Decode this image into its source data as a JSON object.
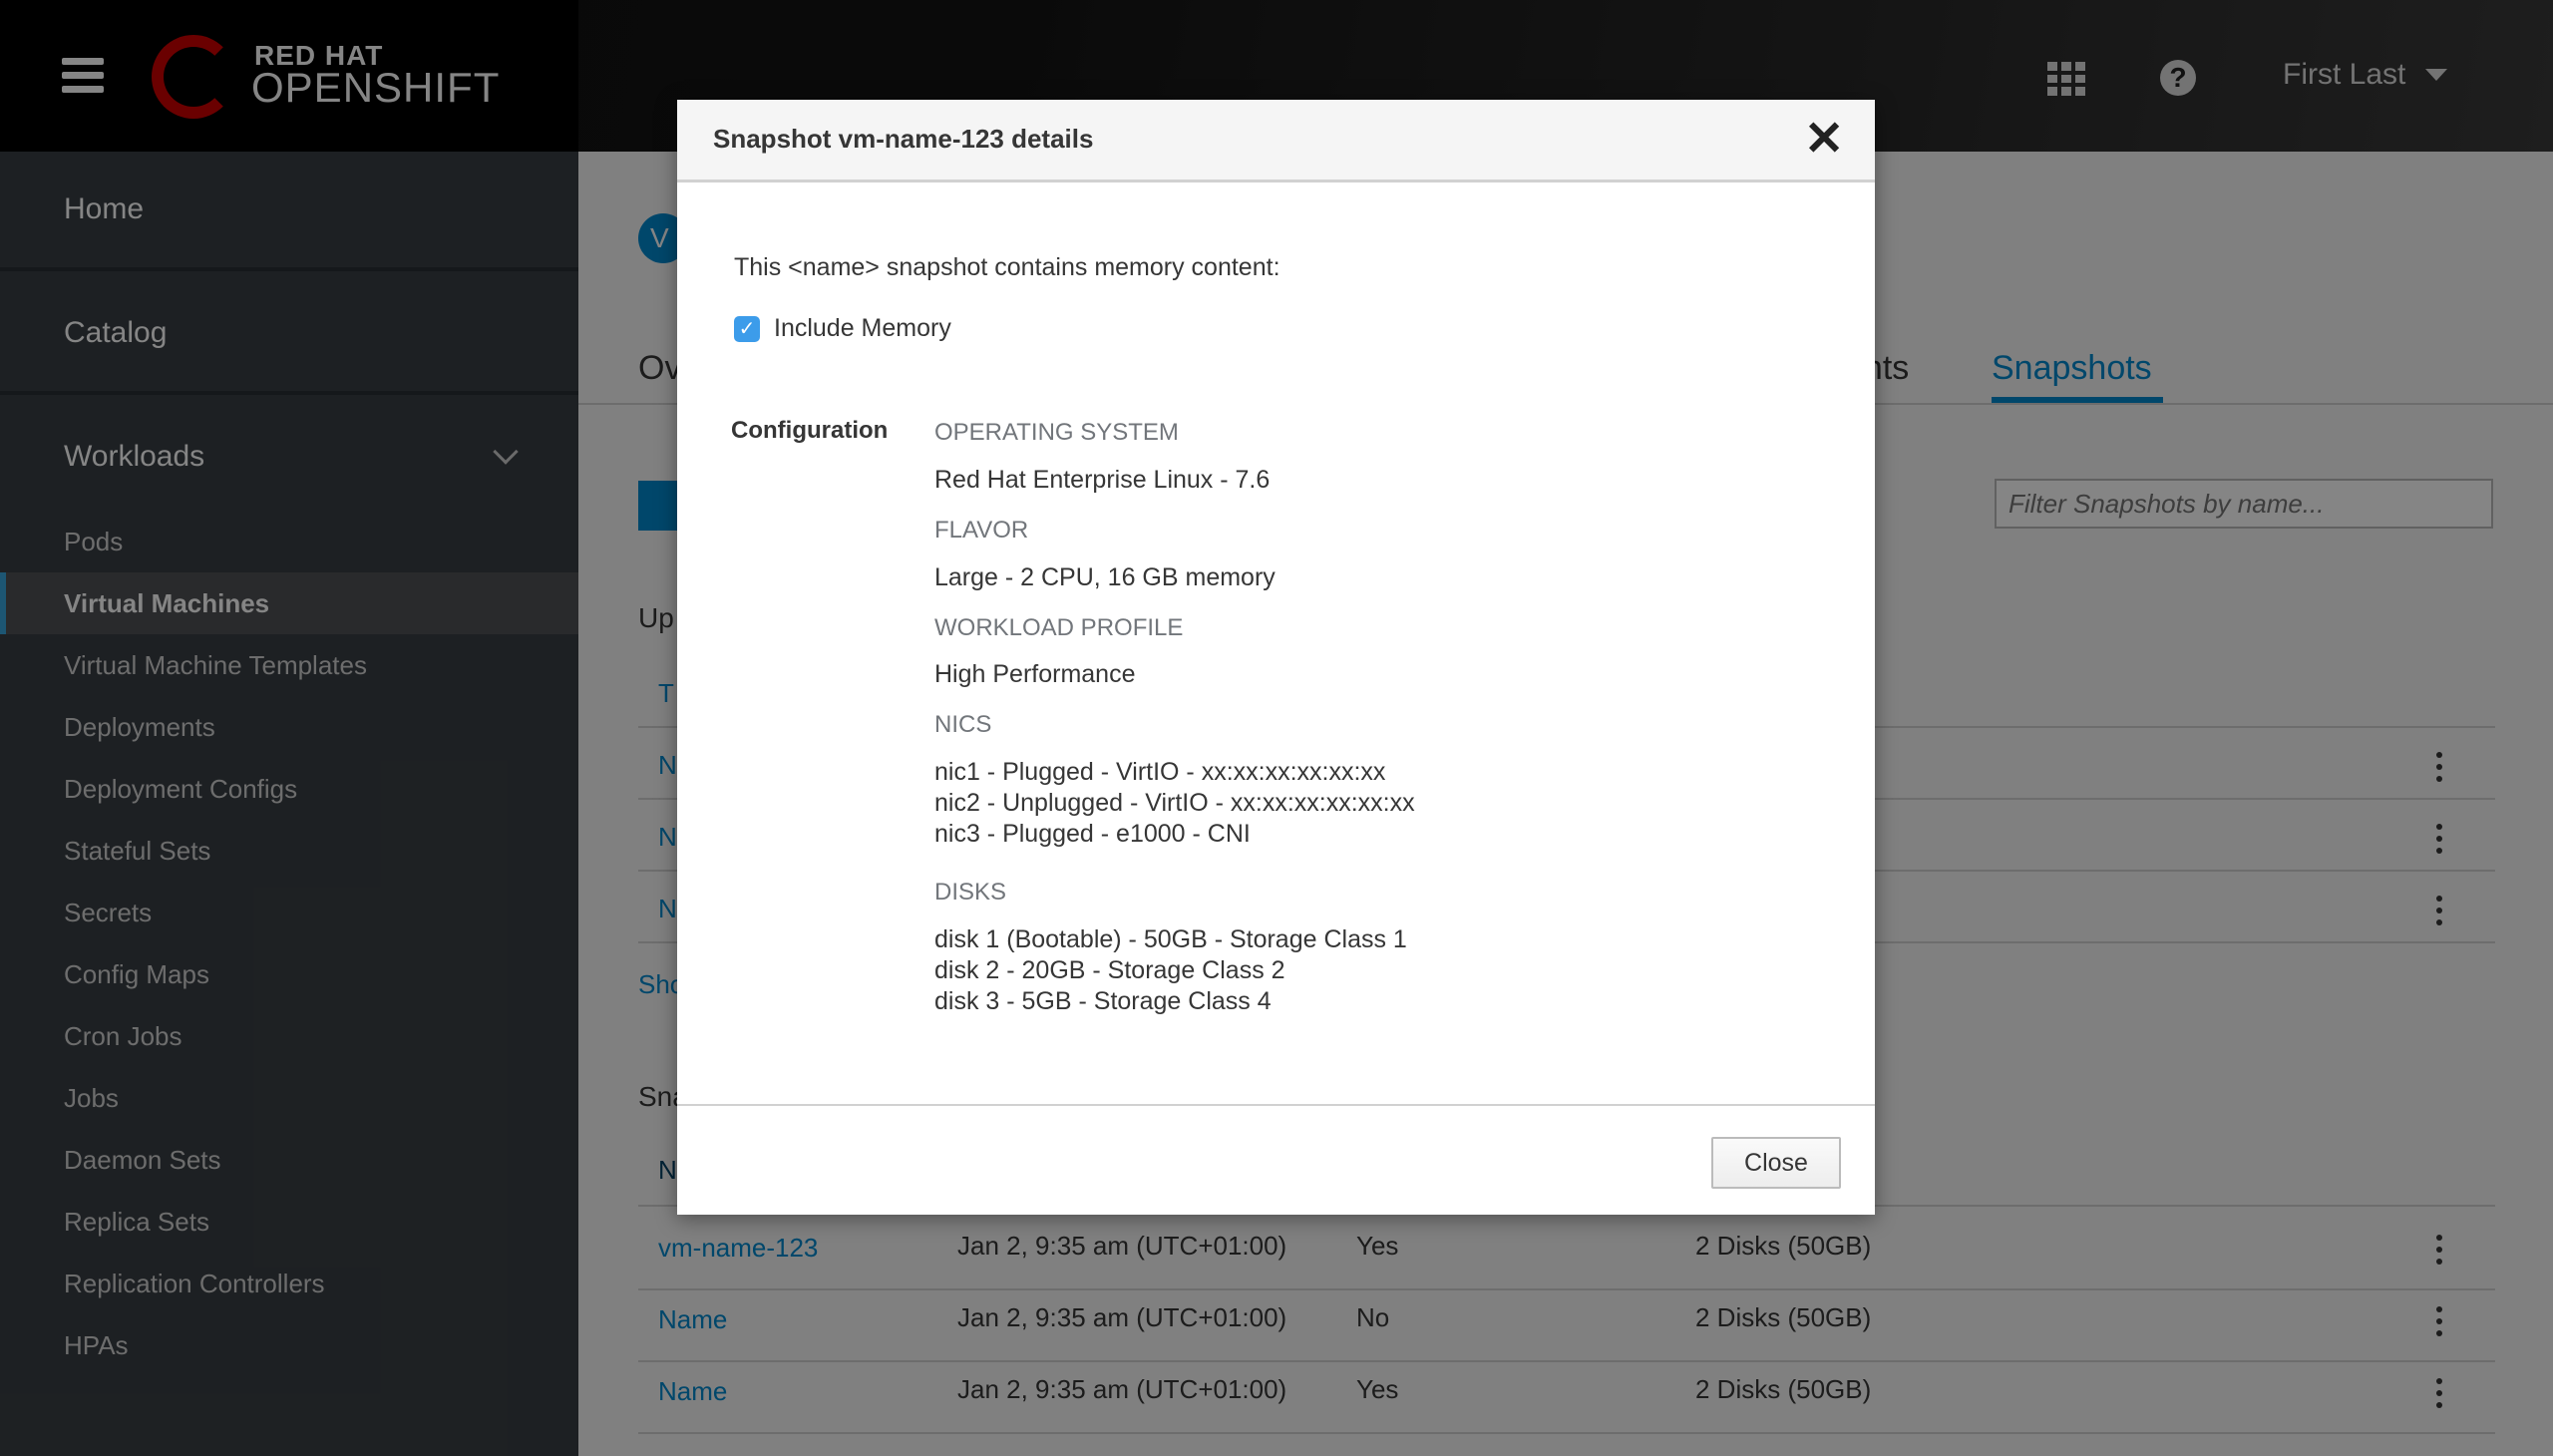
{
  "header": {
    "brand_top": "RED HAT",
    "brand_bottom": "OPENSHIFT",
    "user": "First Last"
  },
  "sidebar": {
    "top": [
      "Home",
      "Catalog",
      "Workloads"
    ],
    "items": [
      "Pods",
      "Virtual Machines",
      "Virtual Machine Templates",
      "Deployments",
      "Deployment Configs",
      "Stateful Sets",
      "Secrets",
      "Config Maps",
      "Cron Jobs",
      "Jobs",
      "Daemon Sets",
      "Replica Sets",
      "Replication Controllers",
      "HPAs"
    ],
    "active": "Virtual Machines"
  },
  "main": {
    "badge": "V",
    "tab_left_partial": "Ov",
    "tab_mid_partial": "ents",
    "tab_active": "Snapshots",
    "filter_placeholder": "Filter Snapshots by name...",
    "upper_heading_partial": "Up",
    "upper_col_partial": "T",
    "upper_rows_partial": [
      "N",
      "N",
      "N"
    ],
    "show_link_partial": "Sho",
    "snap_heading_partial": "Sna",
    "snap_col_partial": "N",
    "snapshots": [
      {
        "name": "vm-name-123",
        "date": "Jan 2, 9:35 am (UTC+01:00)",
        "memory": "Yes",
        "disks": "2 Disks (50GB)"
      },
      {
        "name": "Name",
        "date": "Jan 2, 9:35 am (UTC+01:00)",
        "memory": "No",
        "disks": "2 Disks (50GB)"
      },
      {
        "name": "Name",
        "date": "Jan 2, 9:35 am (UTC+01:00)",
        "memory": "Yes",
        "disks": "2 Disks (50GB)"
      }
    ]
  },
  "modal": {
    "title": "Snapshot vm-name-123 details",
    "intro": "This <name> snapshot contains memory content:",
    "include_memory": "Include Memory",
    "include_memory_checked": true,
    "config_label": "Configuration",
    "os_label": "OPERATING SYSTEM",
    "os": "Red Hat Enterprise Linux - 7.6",
    "flavor_label": "FLAVOR",
    "flavor": "Large - 2 CPU, 16 GB memory",
    "profile_label": "WORKLOAD PROFILE",
    "profile": "High Performance",
    "nics_label": "NICS",
    "nics": [
      "nic1 - Plugged - VirtIO - xx:xx:xx:xx:xx:xx",
      "nic2 - Unplugged - VirtIO - xx:xx:xx:xx:xx:xx",
      "nic3 - Plugged - e1000 - CNI"
    ],
    "disks_label": "DISKS",
    "disks": [
      "disk 1 (Bootable) - 50GB - Storage Class 1",
      "disk 2 - 20GB - Storage Class 2",
      "disk 3 - 5GB - Storage Class 4"
    ],
    "close_button": "Close"
  }
}
